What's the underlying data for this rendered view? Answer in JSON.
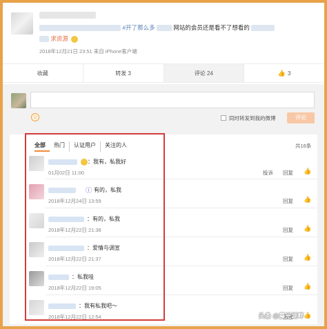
{
  "post": {
    "text_suffix": "#开了那么多",
    "text_suffix2": "网站的会员还是看不了想看的",
    "request_link": "求资源",
    "meta": "2018年12月21日 23:51 来自 iPhone客户端"
  },
  "actions": {
    "favorite": "收藏",
    "repost": "转发 3",
    "comment": "评论 24",
    "like": "3"
  },
  "composer": {
    "repost_label": "同时转发到我的微博",
    "submit_label": "评论"
  },
  "comments_header": {
    "tabs": [
      "全部",
      "热门",
      "认证用户",
      "关注的人"
    ],
    "total": "共16条"
  },
  "comments": [
    {
      "text": "：我有，私我好",
      "time": "01月02日 11:00",
      "report": "投诉",
      "reply": "回复"
    },
    {
      "text": "有的，私我",
      "time": "2018年12月24日 13:59",
      "reply": "回复"
    },
    {
      "text": "：有的，私我",
      "time": "2018年12月22日 21:38",
      "reply": "回复"
    },
    {
      "text": "：爱情与调宣",
      "time": "2018年12月22日 21:37",
      "reply": "回复"
    },
    {
      "text": "：私我哇",
      "time": "2018年12月22日 19:05",
      "reply": "回复"
    },
    {
      "text": "：我有私我吧～",
      "time": "2018年12月22日 12:54",
      "reply": "回复"
    }
  ],
  "watermark": "头条 @晨光湖畔",
  "colors": {
    "highlight": "#d43a3a",
    "border": "#e8a24a",
    "link": "#5a82b8",
    "submit_bg": "#f8c8a6"
  }
}
